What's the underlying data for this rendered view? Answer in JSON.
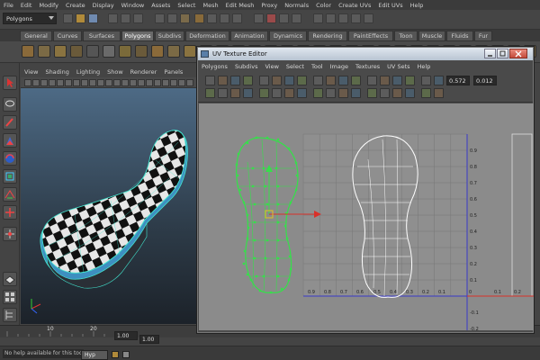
{
  "menubar": [
    "File",
    "Edit",
    "Modify",
    "Create",
    "Display",
    "Window",
    "Assets",
    "Select",
    "Mesh",
    "Edit Mesh",
    "Proxy",
    "Normals",
    "Color",
    "Create UVs",
    "Edit UVs",
    "Help"
  ],
  "statusline": {
    "mode": "Polygons"
  },
  "shelf_tabs": [
    "General",
    "Curves",
    "Surfaces",
    "Polygons",
    "Subdivs",
    "Deformation",
    "Animation",
    "Dynamics",
    "Rendering",
    "PaintEffects",
    "Toon",
    "Muscle",
    "Fluids",
    "Fur"
  ],
  "shelf_active_tab": "Polygons",
  "viewport": {
    "menu": [
      "View",
      "Shading",
      "Lighting",
      "Show",
      "Renderer",
      "Panels"
    ]
  },
  "uv_editor": {
    "title": "UV Texture Editor",
    "menu": [
      "Polygons",
      "Subdivs",
      "View",
      "Select",
      "Tool",
      "Image",
      "Textures",
      "UV Sets",
      "Help"
    ],
    "u_value": "0.572",
    "v_value": "0.012",
    "v_ticks": [
      "0.9",
      "0.8",
      "0.7",
      "0.6",
      "0.5",
      "0.4",
      "0.3",
      "0.2",
      "0.1",
      "-0.1",
      "-0.2"
    ],
    "u_ticks": [
      "0.9",
      "0.8",
      "0.7",
      "0.6",
      "0.5",
      "0.4",
      "0.3",
      "0.2",
      "0.1",
      "0.1",
      "0.2"
    ],
    "origin_label": "0"
  },
  "timeslider": {
    "tick_10": "10",
    "tick_20": "20",
    "range_start": "1.00",
    "range_end": "1.00"
  },
  "helpline": {
    "text": "No help available for this tool"
  },
  "taskbar": {
    "item": "Hyp"
  },
  "colors": {
    "uv_selected": "#35e04a",
    "uv_wire": "#ffffff",
    "u_axis": "#d9302a",
    "v_axis": "#3a3ac8",
    "viewport_top": "#4d6a85",
    "viewport_bottom": "#1c2229"
  }
}
